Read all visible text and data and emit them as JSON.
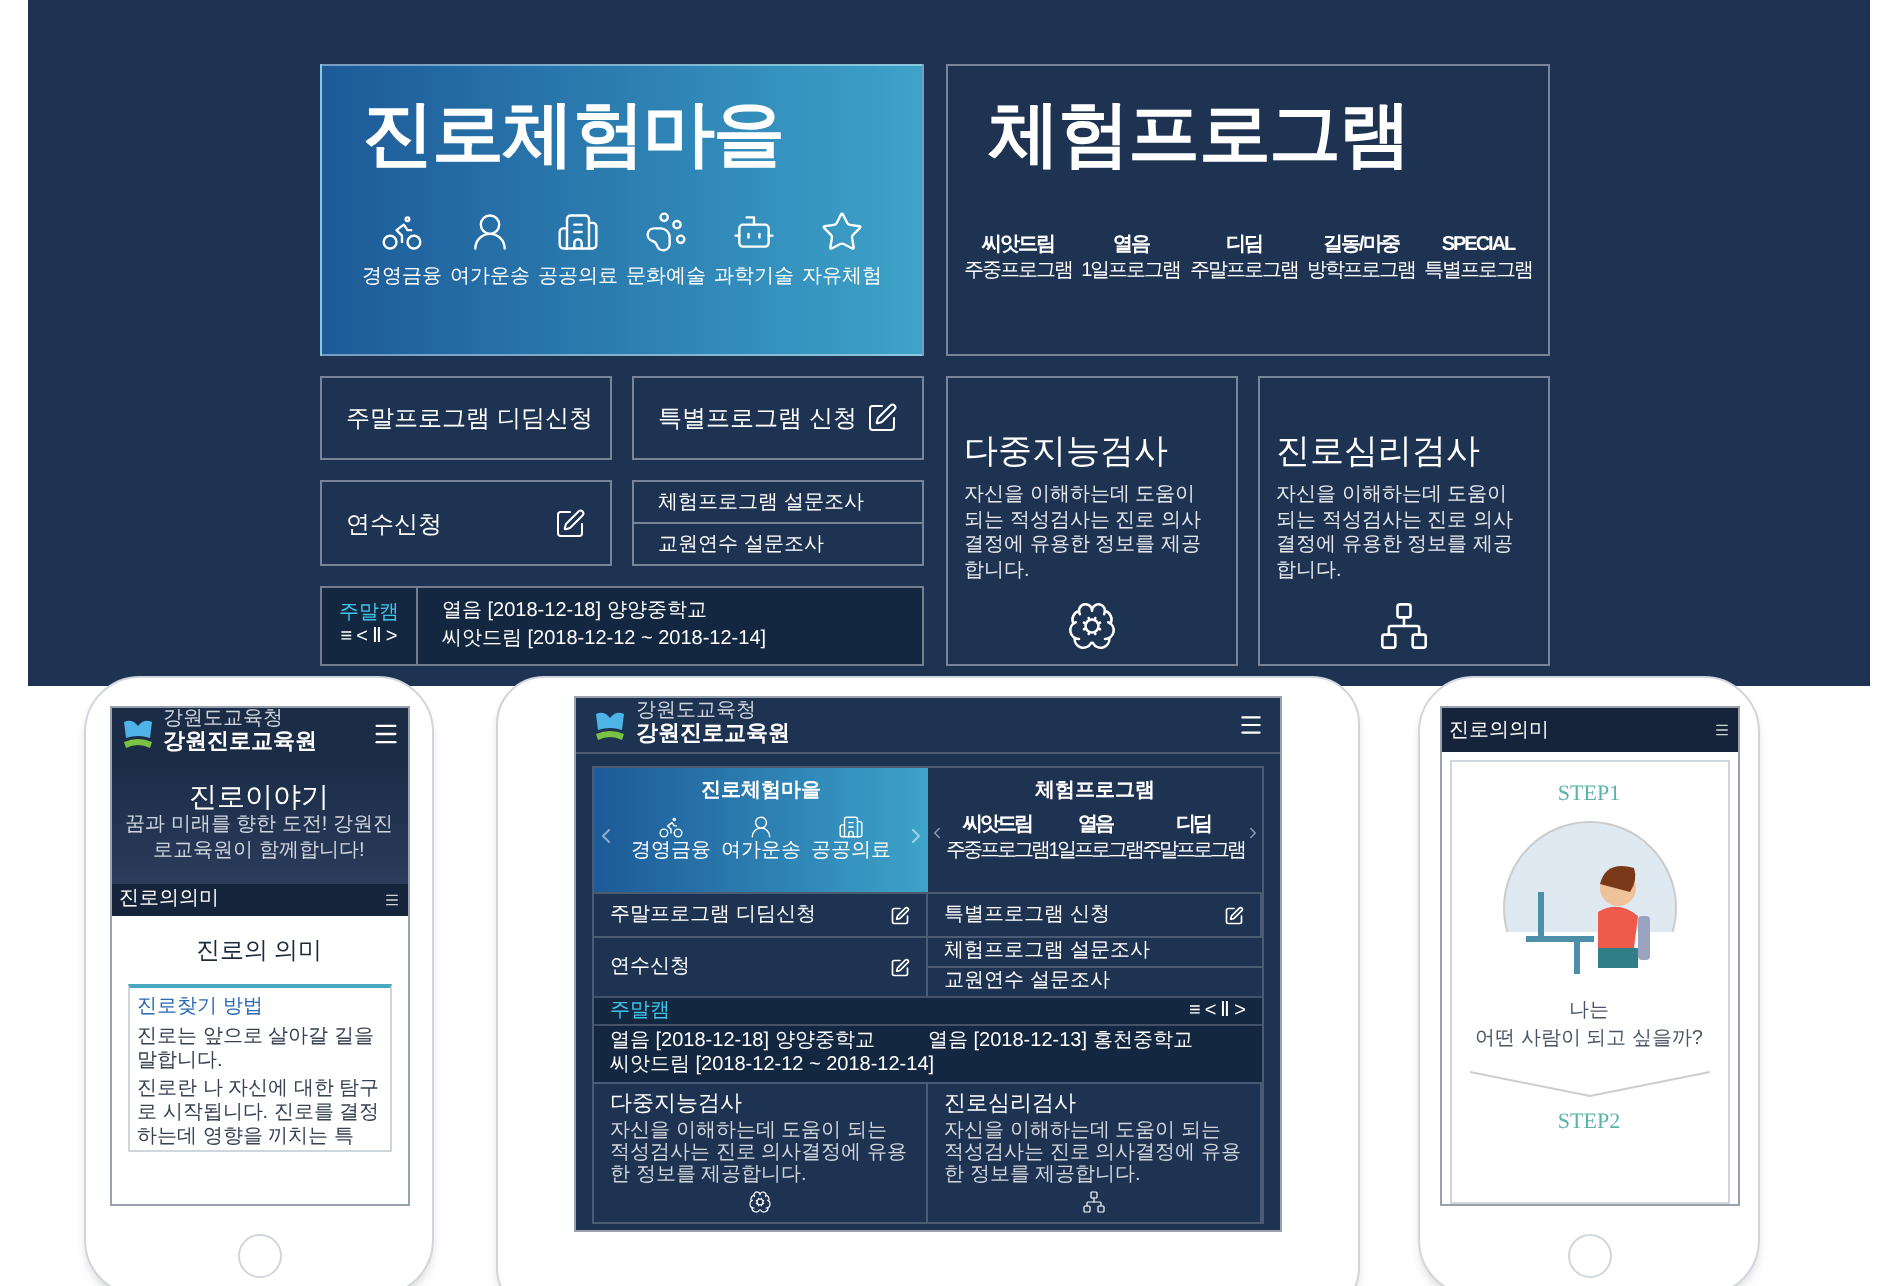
{
  "desktop": {
    "village": {
      "title": "진로체험마을",
      "categories": [
        "경영금융",
        "여가운송",
        "공공의료",
        "문화예술",
        "과학기술",
        "자유체험"
      ]
    },
    "programs": {
      "title": "체험프로그램",
      "items": [
        {
          "name": "씨앗드림",
          "sub": "주중프로그램"
        },
        {
          "name": "열음",
          "sub": "1일프로그램"
        },
        {
          "name": "디딤",
          "sub": "주말프로그램"
        },
        {
          "name": "길동/마중",
          "sub": "방학프로그램"
        },
        {
          "name": "SPECIAL",
          "sub": "특별프로그램"
        }
      ]
    },
    "applications": [
      "주말프로그램 디딤신청",
      "특별프로그램 신청",
      "연수신청"
    ],
    "surveys": [
      "체험프로그램 설문조사",
      "교원연수 설문조사"
    ],
    "notice": {
      "label": "주말캠",
      "controls": [
        "≡",
        "<",
        "Ⅱ",
        ">"
      ],
      "items": [
        "열음 [2018-12-18] 양양중학교",
        "씨앗드림 [2018-12-12 ~ 2018-12-14]"
      ]
    },
    "tests": [
      {
        "title": "다중지능검사",
        "description": "자신을 이해하는데 도움이 되는 적성검사는 진로 의사결정에 유용한 정보를 제공합니다."
      },
      {
        "title": "진로심리검사",
        "description": "자신을 이해하는데 도움이 되는 적성검사는 진로 의사결정에 유용한 정보를 제공합니다."
      }
    ]
  },
  "phone_left": {
    "logo_small": "강원도교육청",
    "logo": "강원진로교육원",
    "hero_title": "진로이야기",
    "hero_subtitle": "꿈과 미래를 향한 도전! 강원진로교육원이 함께합니다!",
    "breadcrumb": "진로의의미",
    "heading": "진로의 의미",
    "box_title": "진로찾기 방법",
    "bullets": [
      "진로는 앞으로 살아갈 길을 말합니다.",
      "진로란 나 자신에 대한 탐구로 시작됩니다. 진로를 결정하는데 영향을 끼치는 특"
    ]
  },
  "tablet": {
    "logo_small": "강원도교육청",
    "logo": "강원진로교육원",
    "village": {
      "title": "진로체험마을",
      "categories": [
        "경영금융",
        "여가운송",
        "공공의료"
      ]
    },
    "programs": {
      "title": "체험프로그램",
      "items": [
        {
          "name": "씨앗드림",
          "sub": "주중프로그램"
        },
        {
          "name": "열음",
          "sub": "1일프로그램"
        },
        {
          "name": "디딤",
          "sub": "주말프로그램"
        }
      ]
    },
    "applications": [
      "주말프로그램 디딤신청",
      "특별프로그램 신청",
      "연수신청"
    ],
    "surveys": [
      "체험프로그램 설문조사",
      "교원연수 설문조사"
    ],
    "notice": {
      "label": "주말캠",
      "controls": [
        "≡",
        "<",
        "Ⅱ",
        ">"
      ],
      "columns": [
        [
          "열음 [2018-12-18] 양양중학교",
          "씨앗드림 [2018-12-12 ~ 2018-12-14]"
        ],
        [
          "열음 [2018-12-13] 홍천중학교"
        ]
      ]
    },
    "tests": [
      {
        "title": "다중지능검사",
        "description": "자신을 이해하는데 도움이 되는 적성검사는 진로 의사결정에 유용한 정보를 제공합니다."
      },
      {
        "title": "진로심리검사",
        "description": "자신을 이해하는데 도움이 되는 적성검사는 진로 의사결정에 유용한 정보를 제공합니다."
      }
    ]
  },
  "phone_right": {
    "breadcrumb": "진로의의미",
    "step": "STEP1",
    "caption": [
      "나는",
      "어떤 사람이 되고 싶을까?"
    ],
    "next_step": "STEP2"
  }
}
